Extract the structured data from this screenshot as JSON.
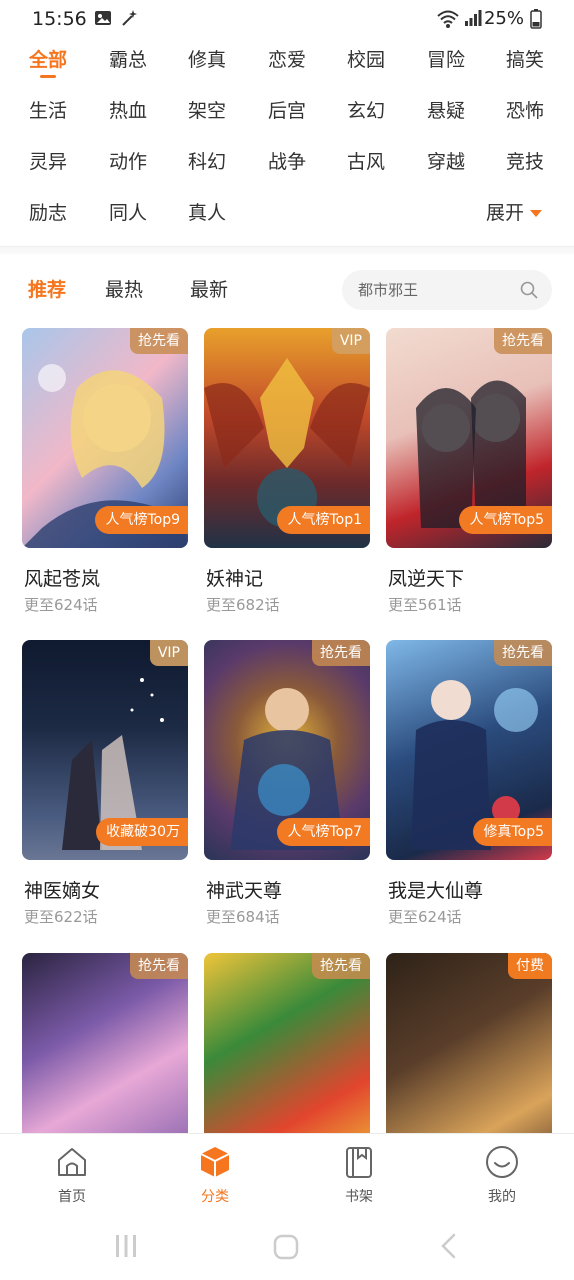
{
  "status_bar": {
    "time": "15:56",
    "battery": "25%"
  },
  "categories": [
    "全部",
    "霸总",
    "修真",
    "恋爱",
    "校园",
    "冒险",
    "搞笑",
    "生活",
    "热血",
    "架空",
    "后宫",
    "玄幻",
    "悬疑",
    "恐怖",
    "灵异",
    "动作",
    "科幻",
    "战争",
    "古风",
    "穿越",
    "竞技",
    "励志",
    "同人",
    "真人"
  ],
  "active_category": "全部",
  "expand_label": "展开",
  "sort_tabs": [
    "推荐",
    "最热",
    "最新"
  ],
  "active_sort": "推荐",
  "search": {
    "placeholder": "都市邪王"
  },
  "comics": [
    {
      "title": "风起苍岚",
      "episodes": "更至624话",
      "badge": "抢先看",
      "rank": "人气榜Top9",
      "cover_colors": [
        "#a9c6ea",
        "#f1b8c8",
        "#2c3e6e"
      ]
    },
    {
      "title": "妖神记",
      "episodes": "更至682话",
      "badge": "VIP",
      "rank": "人气榜Top1",
      "cover_colors": [
        "#c24a2a",
        "#e8a02b",
        "#203246"
      ]
    },
    {
      "title": "凤逆天下",
      "episodes": "更至561话",
      "badge": "抢先看",
      "rank": "人气榜Top5",
      "cover_colors": [
        "#f2dbd0",
        "#c0252b",
        "#2a2a38"
      ]
    },
    {
      "title": "神医嫡女",
      "episodes": "更至622话",
      "badge": "VIP",
      "rank": "收藏破30万",
      "cover_colors": [
        "#1d2a44",
        "#495b80",
        "#d6c7c0"
      ]
    },
    {
      "title": "神武天尊",
      "episodes": "更至684话",
      "badge": "抢先看",
      "rank": "人气榜Top7",
      "cover_colors": [
        "#2a3458",
        "#e3b23c",
        "#5a3a6a"
      ]
    },
    {
      "title": "我是大仙尊",
      "episodes": "更至624话",
      "badge": "抢先看",
      "rank": "修真Top5",
      "cover_colors": [
        "#2b4c7e",
        "#7fb8e8",
        "#d23a4a"
      ]
    },
    {
      "title": "",
      "episodes": "",
      "badge": "抢先看",
      "rank": "",
      "cover_colors": [
        "#7b5aa8",
        "#e7a8d6",
        "#2a2440"
      ]
    },
    {
      "title": "",
      "episodes": "",
      "badge": "抢先看",
      "rank": "",
      "cover_colors": [
        "#f0c43a",
        "#e2452e",
        "#3a8a3a"
      ]
    },
    {
      "title": "",
      "episodes": "",
      "badge": "付费",
      "rank": "",
      "cover_colors": [
        "#5a3e2a",
        "#d9a35a",
        "#2e2218"
      ]
    }
  ],
  "bottom_nav": [
    {
      "label": "首页",
      "icon": "house-icon",
      "active": false
    },
    {
      "label": "分类",
      "icon": "category-cube-icon",
      "active": true
    },
    {
      "label": "书架",
      "icon": "bookshelf-icon",
      "active": false
    },
    {
      "label": "我的",
      "icon": "smiley-profile-icon",
      "active": false
    }
  ],
  "colors": {
    "accent": "#f5761f",
    "text": "#222222",
    "muted": "#999999"
  }
}
